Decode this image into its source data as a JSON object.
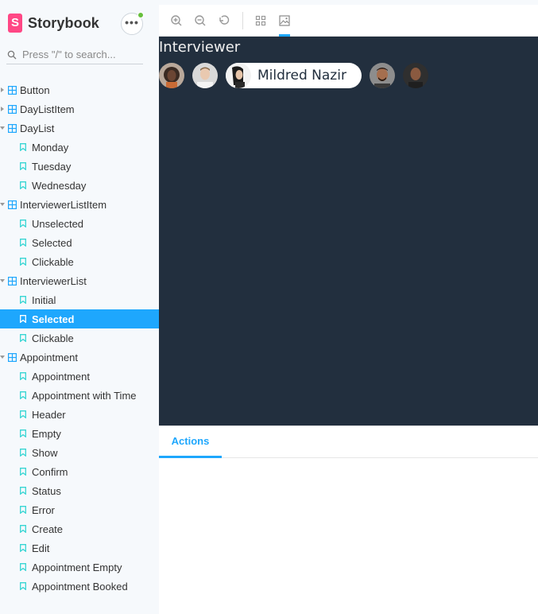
{
  "brand": {
    "name": "Storybook",
    "logo_letter": "S",
    "accent": "#ff4785"
  },
  "search": {
    "placeholder": "Press \"/\" to search..."
  },
  "tree": [
    {
      "type": "component",
      "label": "Button"
    },
    {
      "type": "component",
      "label": "DayListItem"
    },
    {
      "type": "component",
      "label": "DayList",
      "expanded": true
    },
    {
      "type": "story",
      "label": "Monday"
    },
    {
      "type": "story",
      "label": "Tuesday"
    },
    {
      "type": "story",
      "label": "Wednesday"
    },
    {
      "type": "component",
      "label": "InterviewerListItem",
      "expanded": true
    },
    {
      "type": "story",
      "label": "Unselected"
    },
    {
      "type": "story",
      "label": "Selected"
    },
    {
      "type": "story",
      "label": "Clickable"
    },
    {
      "type": "component",
      "label": "InterviewerList",
      "expanded": true
    },
    {
      "type": "story",
      "label": "Initial"
    },
    {
      "type": "story",
      "label": "Selected",
      "selected": true
    },
    {
      "type": "story",
      "label": "Clickable"
    },
    {
      "type": "component",
      "label": "Appointment",
      "expanded": true
    },
    {
      "type": "story",
      "label": "Appointment"
    },
    {
      "type": "story",
      "label": "Appointment with Time"
    },
    {
      "type": "story",
      "label": "Header"
    },
    {
      "type": "story",
      "label": "Empty"
    },
    {
      "type": "story",
      "label": "Show"
    },
    {
      "type": "story",
      "label": "Confirm"
    },
    {
      "type": "story",
      "label": "Status"
    },
    {
      "type": "story",
      "label": "Error"
    },
    {
      "type": "story",
      "label": "Create"
    },
    {
      "type": "story",
      "label": "Edit"
    },
    {
      "type": "story",
      "label": "Appointment Empty"
    },
    {
      "type": "story",
      "label": "Appointment Booked"
    }
  ],
  "toolbar": {
    "buttons": [
      "zoom-in-icon",
      "zoom-out-icon",
      "zoom-reset-icon",
      "grid-icon",
      "image-icon"
    ],
    "active": "image-icon"
  },
  "preview": {
    "title": "Interviewer",
    "background": "#222f3e",
    "selected_name": "Mildred Nazir"
  },
  "addons": {
    "tab": "Actions"
  },
  "colors": {
    "selection": "#1ea7fd",
    "story_icon": "#37d5d3",
    "component_icon": "#1ea7fd",
    "notification": "#66bf3c"
  }
}
